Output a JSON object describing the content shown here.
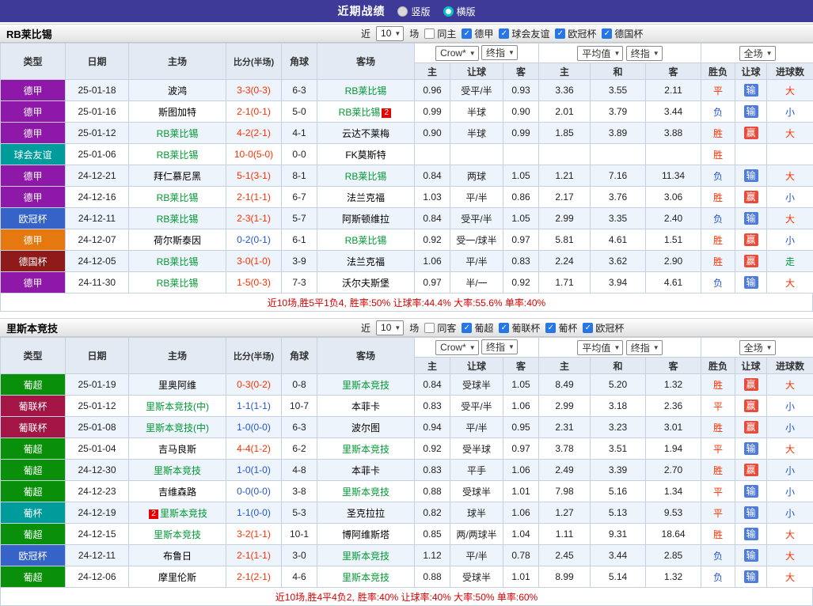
{
  "topbar": {
    "title": "近期战绩",
    "vertical": "竖版",
    "horizontal": "横版"
  },
  "sections": [
    {
      "team": "RB莱比锡",
      "filter": {
        "near": "近",
        "count": "10",
        "games": "场",
        "same": "同主",
        "same_checked": false,
        "leagues": [
          {
            "label": "德甲",
            "checked": true
          },
          {
            "label": "球会友谊",
            "checked": true
          },
          {
            "label": "欧冠杯",
            "checked": true
          },
          {
            "label": "德国杯",
            "checked": true
          }
        ]
      },
      "dropdowns": {
        "source": "Crow*",
        "time1": "终指",
        "avg": "平均值",
        "time2": "终指",
        "scope": "全场"
      },
      "columns": [
        "类型",
        "日期",
        "主场",
        "比分(半场)",
        "角球",
        "客场",
        "主",
        "让球",
        "客",
        "主",
        "和",
        "客",
        "胜负",
        "让球",
        "进球数"
      ],
      "rows": [
        {
          "league": "德甲",
          "league_color": "#8e18a8",
          "date": "25-01-18",
          "home": "波鸿",
          "home_focus": false,
          "home_card": "",
          "score": "3-3(0-3)",
          "score_color": "r",
          "corners": "6-3",
          "away": "RB莱比锡",
          "away_focus": true,
          "away_card": "",
          "ah_home": "0.96",
          "ah_line": "受平/半",
          "ah_away": "0.93",
          "eu_home": "3.36",
          "eu_draw": "3.55",
          "eu_away": "2.11",
          "result": "平",
          "result_color": "r",
          "handicap": "输",
          "handicap_color": "b",
          "goals": "大",
          "goals_color": "r"
        },
        {
          "league": "德甲",
          "league_color": "#8e18a8",
          "date": "25-01-16",
          "home": "斯图加特",
          "home_focus": false,
          "home_card": "",
          "score": "2-1(0-1)",
          "score_color": "r",
          "corners": "5-0",
          "away": "RB莱比锡",
          "away_focus": true,
          "away_card": "2",
          "ah_home": "0.99",
          "ah_line": "半球",
          "ah_away": "0.90",
          "eu_home": "2.01",
          "eu_draw": "3.79",
          "eu_away": "3.44",
          "result": "负",
          "result_color": "b",
          "handicap": "输",
          "handicap_color": "b",
          "goals": "小",
          "goals_color": "b"
        },
        {
          "league": "德甲",
          "league_color": "#8e18a8",
          "date": "25-01-12",
          "home": "RB莱比锡",
          "home_focus": true,
          "home_card": "",
          "score": "4-2(2-1)",
          "score_color": "r",
          "corners": "4-1",
          "away": "云达不莱梅",
          "away_focus": false,
          "away_card": "",
          "ah_home": "0.90",
          "ah_line": "半球",
          "ah_away": "0.99",
          "eu_home": "1.85",
          "eu_draw": "3.89",
          "eu_away": "3.88",
          "result": "胜",
          "result_color": "r",
          "handicap": "赢",
          "handicap_color": "r",
          "goals": "大",
          "goals_color": "r"
        },
        {
          "league": "球会友谊",
          "league_color": "#009c9c",
          "date": "25-01-06",
          "home": "RB莱比锡",
          "home_focus": true,
          "home_card": "",
          "score": "10-0(5-0)",
          "score_color": "r",
          "corners": "0-0",
          "away": "FK莫斯特",
          "away_focus": false,
          "away_card": "",
          "ah_home": "",
          "ah_line": "",
          "ah_away": "",
          "eu_home": "",
          "eu_draw": "",
          "eu_away": "",
          "result": "胜",
          "result_color": "r",
          "handicap": "",
          "handicap_color": "",
          "goals": "",
          "goals_color": ""
        },
        {
          "league": "德甲",
          "league_color": "#8e18a8",
          "date": "24-12-21",
          "home": "拜仁慕尼黑",
          "home_focus": false,
          "home_card": "",
          "score": "5-1(3-1)",
          "score_color": "r",
          "corners": "8-1",
          "away": "RB莱比锡",
          "away_focus": true,
          "away_card": "",
          "ah_home": "0.84",
          "ah_line": "两球",
          "ah_away": "1.05",
          "eu_home": "1.21",
          "eu_draw": "7.16",
          "eu_away": "11.34",
          "result": "负",
          "result_color": "b",
          "handicap": "输",
          "handicap_color": "b",
          "goals": "大",
          "goals_color": "r"
        },
        {
          "league": "德甲",
          "league_color": "#8e18a8",
          "date": "24-12-16",
          "home": "RB莱比锡",
          "home_focus": true,
          "home_card": "",
          "score": "2-1(1-1)",
          "score_color": "r",
          "corners": "6-7",
          "away": "法兰克福",
          "away_focus": false,
          "away_card": "",
          "ah_home": "1.03",
          "ah_line": "平/半",
          "ah_away": "0.86",
          "eu_home": "2.17",
          "eu_draw": "3.76",
          "eu_away": "3.06",
          "result": "胜",
          "result_color": "r",
          "handicap": "赢",
          "handicap_color": "r",
          "goals": "小",
          "goals_color": "b"
        },
        {
          "league": "欧冠杯",
          "league_color": "#3563c8",
          "date": "24-12-11",
          "home": "RB莱比锡",
          "home_focus": true,
          "home_card": "",
          "score": "2-3(1-1)",
          "score_color": "r",
          "corners": "5-7",
          "away": "阿斯顿维拉",
          "away_focus": false,
          "away_card": "",
          "ah_home": "0.84",
          "ah_line": "受平/半",
          "ah_away": "1.05",
          "eu_home": "2.99",
          "eu_draw": "3.35",
          "eu_away": "2.40",
          "result": "负",
          "result_color": "b",
          "handicap": "输",
          "handicap_color": "b",
          "goals": "大",
          "goals_color": "r"
        },
        {
          "league": "德甲",
          "league_color": "#e5790f",
          "date": "24-12-07",
          "home": "荷尔斯泰因",
          "home_focus": false,
          "home_card": "",
          "score": "0-2(0-1)",
          "score_color": "b",
          "corners": "6-1",
          "away": "RB莱比锡",
          "away_focus": true,
          "away_card": "",
          "ah_home": "0.92",
          "ah_line": "受一/球半",
          "ah_away": "0.97",
          "eu_home": "5.81",
          "eu_draw": "4.61",
          "eu_away": "1.51",
          "result": "胜",
          "result_color": "r",
          "handicap": "赢",
          "handicap_color": "r",
          "goals": "小",
          "goals_color": "b"
        },
        {
          "league": "德国杯",
          "league_color": "#8e1a1a",
          "date": "24-12-05",
          "home": "RB莱比锡",
          "home_focus": true,
          "home_card": "",
          "score": "3-0(1-0)",
          "score_color": "r",
          "corners": "3-9",
          "away": "法兰克福",
          "away_focus": false,
          "away_card": "",
          "ah_home": "1.06",
          "ah_line": "平/半",
          "ah_away": "0.83",
          "eu_home": "2.24",
          "eu_draw": "3.62",
          "eu_away": "2.90",
          "result": "胜",
          "result_color": "r",
          "handicap": "赢",
          "handicap_color": "r",
          "goals": "走",
          "goals_color": "g"
        },
        {
          "league": "德甲",
          "league_color": "#8e18a8",
          "date": "24-11-30",
          "home": "RB莱比锡",
          "home_focus": true,
          "home_card": "",
          "score": "1-5(0-3)",
          "score_color": "r",
          "corners": "7-3",
          "away": "沃尔夫斯堡",
          "away_focus": false,
          "away_card": "",
          "ah_home": "0.97",
          "ah_line": "半/一",
          "ah_away": "0.92",
          "eu_home": "1.71",
          "eu_draw": "3.94",
          "eu_away": "4.61",
          "result": "负",
          "result_color": "b",
          "handicap": "输",
          "handicap_color": "b",
          "goals": "大",
          "goals_color": "r"
        }
      ],
      "summary": {
        "prefix": "近10场,胜5平1负4,",
        "rates": "胜率:50% 让球率:44.4% 大率:55.6% 单率:40%"
      }
    },
    {
      "team": "里斯本竞技",
      "filter": {
        "near": "近",
        "count": "10",
        "games": "场",
        "same": "同客",
        "same_checked": false,
        "leagues": [
          {
            "label": "葡超",
            "checked": true
          },
          {
            "label": "葡联杯",
            "checked": true
          },
          {
            "label": "葡杯",
            "checked": true
          },
          {
            "label": "欧冠杯",
            "checked": true
          }
        ]
      },
      "dropdowns": {
        "source": "Crow*",
        "time1": "终指",
        "avg": "平均值",
        "time2": "终指",
        "scope": "全场"
      },
      "columns": [
        "类型",
        "日期",
        "主场",
        "比分(半场)",
        "角球",
        "客场",
        "主",
        "让球",
        "客",
        "主",
        "和",
        "客",
        "胜负",
        "让球",
        "进球数"
      ],
      "rows": [
        {
          "league": "葡超",
          "league_color": "#0a8f0a",
          "date": "25-01-19",
          "home": "里奥阿维",
          "home_focus": false,
          "home_card": "",
          "score": "0-3(0-2)",
          "score_color": "r",
          "corners": "0-8",
          "away": "里斯本竞技",
          "away_focus": true,
          "away_card": "",
          "ah_home": "0.84",
          "ah_line": "受球半",
          "ah_away": "1.05",
          "eu_home": "8.49",
          "eu_draw": "5.20",
          "eu_away": "1.32",
          "result": "胜",
          "result_color": "r",
          "handicap": "赢",
          "handicap_color": "r",
          "goals": "大",
          "goals_color": "r"
        },
        {
          "league": "葡联杯",
          "league_color": "#a31545",
          "date": "25-01-12",
          "home": "里斯本竞技(中)",
          "home_focus": true,
          "home_card": "",
          "score": "1-1(1-1)",
          "score_color": "b",
          "corners": "10-7",
          "away": "本菲卡",
          "away_focus": false,
          "away_card": "",
          "ah_home": "0.83",
          "ah_line": "受平/半",
          "ah_away": "1.06",
          "eu_home": "2.99",
          "eu_draw": "3.18",
          "eu_away": "2.36",
          "result": "平",
          "result_color": "r",
          "handicap": "赢",
          "handicap_color": "r",
          "goals": "小",
          "goals_color": "b"
        },
        {
          "league": "葡联杯",
          "league_color": "#a31545",
          "date": "25-01-08",
          "home": "里斯本竞技(中)",
          "home_focus": true,
          "home_card": "",
          "score": "1-0(0-0)",
          "score_color": "b",
          "corners": "6-3",
          "away": "波尔图",
          "away_focus": false,
          "away_card": "",
          "ah_home": "0.94",
          "ah_line": "平/半",
          "ah_away": "0.95",
          "eu_home": "2.31",
          "eu_draw": "3.23",
          "eu_away": "3.01",
          "result": "胜",
          "result_color": "r",
          "handicap": "赢",
          "handicap_color": "r",
          "goals": "小",
          "goals_color": "b"
        },
        {
          "league": "葡超",
          "league_color": "#0a8f0a",
          "date": "25-01-04",
          "home": "吉马良斯",
          "home_focus": false,
          "home_card": "",
          "score": "4-4(1-2)",
          "score_color": "r",
          "corners": "6-2",
          "away": "里斯本竞技",
          "away_focus": true,
          "away_card": "",
          "ah_home": "0.92",
          "ah_line": "受半球",
          "ah_away": "0.97",
          "eu_home": "3.78",
          "eu_draw": "3.51",
          "eu_away": "1.94",
          "result": "平",
          "result_color": "r",
          "handicap": "输",
          "handicap_color": "b",
          "goals": "大",
          "goals_color": "r"
        },
        {
          "league": "葡超",
          "league_color": "#0a8f0a",
          "date": "24-12-30",
          "home": "里斯本竞技",
          "home_focus": true,
          "home_card": "",
          "score": "1-0(1-0)",
          "score_color": "b",
          "corners": "4-8",
          "away": "本菲卡",
          "away_focus": false,
          "away_card": "",
          "ah_home": "0.83",
          "ah_line": "平手",
          "ah_away": "1.06",
          "eu_home": "2.49",
          "eu_draw": "3.39",
          "eu_away": "2.70",
          "result": "胜",
          "result_color": "r",
          "handicap": "赢",
          "handicap_color": "r",
          "goals": "小",
          "goals_color": "b"
        },
        {
          "league": "葡超",
          "league_color": "#0a8f0a",
          "date": "24-12-23",
          "home": "吉维森路",
          "home_focus": false,
          "home_card": "",
          "score": "0-0(0-0)",
          "score_color": "b",
          "corners": "3-8",
          "away": "里斯本竞技",
          "away_focus": true,
          "away_card": "",
          "ah_home": "0.88",
          "ah_line": "受球半",
          "ah_away": "1.01",
          "eu_home": "7.98",
          "eu_draw": "5.16",
          "eu_away": "1.34",
          "result": "平",
          "result_color": "r",
          "handicap": "输",
          "handicap_color": "b",
          "goals": "小",
          "goals_color": "b"
        },
        {
          "league": "葡杯",
          "league_color": "#009c9c",
          "date": "24-12-19",
          "home": "里斯本竞技",
          "home_focus": true,
          "home_card": "2",
          "score": "1-1(0-0)",
          "score_color": "b",
          "corners": "5-3",
          "away": "圣克拉拉",
          "away_focus": false,
          "away_card": "",
          "ah_home": "0.82",
          "ah_line": "球半",
          "ah_away": "1.06",
          "eu_home": "1.27",
          "eu_draw": "5.13",
          "eu_away": "9.53",
          "result": "平",
          "result_color": "r",
          "handicap": "输",
          "handicap_color": "b",
          "goals": "小",
          "goals_color": "b"
        },
        {
          "league": "葡超",
          "league_color": "#0a8f0a",
          "date": "24-12-15",
          "home": "里斯本竞技",
          "home_focus": true,
          "home_card": "",
          "score": "3-2(1-1)",
          "score_color": "r",
          "corners": "10-1",
          "away": "博阿维斯塔",
          "away_focus": false,
          "away_card": "",
          "ah_home": "0.85",
          "ah_line": "两/两球半",
          "ah_away": "1.04",
          "eu_home": "1.11",
          "eu_draw": "9.31",
          "eu_away": "18.64",
          "result": "胜",
          "result_color": "r",
          "handicap": "输",
          "handicap_color": "b",
          "goals": "大",
          "goals_color": "r"
        },
        {
          "league": "欧冠杯",
          "league_color": "#3563c8",
          "date": "24-12-11",
          "home": "布鲁日",
          "home_focus": false,
          "home_card": "",
          "score": "2-1(1-1)",
          "score_color": "r",
          "corners": "3-0",
          "away": "里斯本竞技",
          "away_focus": true,
          "away_card": "",
          "ah_home": "1.12",
          "ah_line": "平/半",
          "ah_away": "0.78",
          "eu_home": "2.45",
          "eu_draw": "3.44",
          "eu_away": "2.85",
          "result": "负",
          "result_color": "b",
          "handicap": "输",
          "handicap_color": "b",
          "goals": "大",
          "goals_color": "r"
        },
        {
          "league": "葡超",
          "league_color": "#0a8f0a",
          "date": "24-12-06",
          "home": "摩里伦斯",
          "home_focus": false,
          "home_card": "",
          "score": "2-1(2-1)",
          "score_color": "r",
          "corners": "4-6",
          "away": "里斯本竞技",
          "away_focus": true,
          "away_card": "",
          "ah_home": "0.88",
          "ah_line": "受球半",
          "ah_away": "1.01",
          "eu_home": "8.99",
          "eu_draw": "5.14",
          "eu_away": "1.32",
          "result": "负",
          "result_color": "b",
          "handicap": "输",
          "handicap_color": "b",
          "goals": "大",
          "goals_color": "r"
        }
      ],
      "summary": {
        "prefix": "近10场,胜4平4负2,",
        "rates": "胜率:40% 让球率:40% 大率:50% 单率:60%"
      }
    }
  ]
}
